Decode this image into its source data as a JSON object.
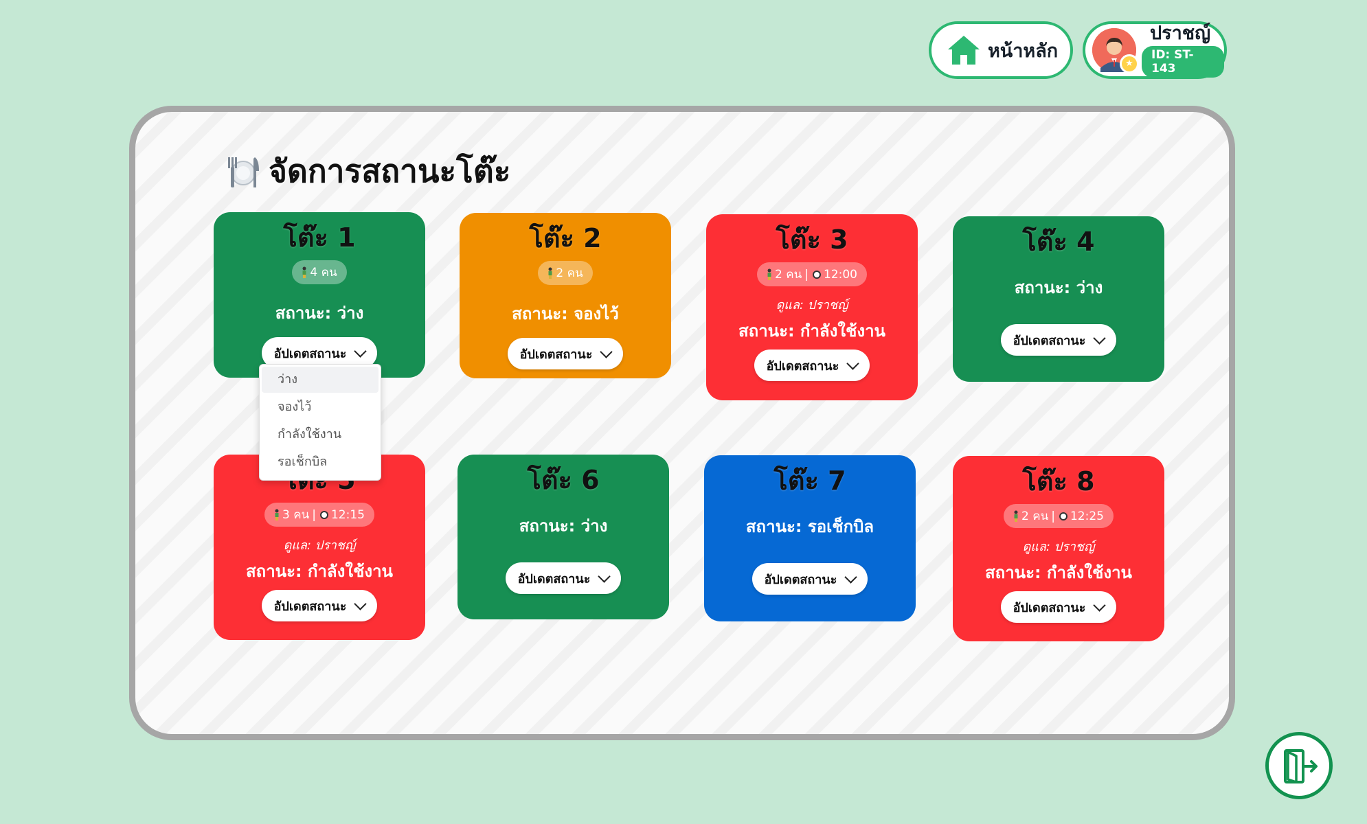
{
  "header": {
    "home_label": "หน้าหลัก",
    "user_name": "ปราชญ์",
    "user_id": "ID: ST-143"
  },
  "page": {
    "title": "จัดการสถานะโต๊ะ"
  },
  "colors": {
    "available": "#178f53",
    "reserved": "#f08f00",
    "occupied": "#fd2f35",
    "awaiting_bill": "#0669d4",
    "accent": "#2db872",
    "background": "#c5e8d4"
  },
  "tables": [
    {
      "title": "โต๊ะ 1",
      "guests": "4 คน",
      "status": "สถานะ: ว่าง",
      "button": "อัปเดตสถานะ"
    },
    {
      "title": "โต๊ะ 2",
      "guests": "2 คน",
      "status": "สถานะ: จองไว้",
      "button": "อัปเดตสถานะ"
    },
    {
      "title": "โต๊ะ 3",
      "guests": "2 คน",
      "time": "12:00",
      "carer": "ดูแล: ปราชญ์",
      "status": "สถานะ: กำลังใช้งาน",
      "button": "อัปเดตสถานะ"
    },
    {
      "title": "โต๊ะ 4",
      "status": "สถานะ: ว่าง",
      "button": "อัปเดตสถานะ"
    },
    {
      "title": "โต๊ะ 5",
      "guests": "3 คน",
      "time": "12:15",
      "carer": "ดูแล: ปราชญ์",
      "status": "สถานะ: กำลังใช้งาน",
      "button": "อัปเดตสถานะ"
    },
    {
      "title": "โต๊ะ 6",
      "status": "สถานะ: ว่าง",
      "button": "อัปเดตสถานะ"
    },
    {
      "title": "โต๊ะ 7",
      "status": "สถานะ: รอเช็กบิล",
      "button": "อัปเดตสถานะ"
    },
    {
      "title": "โต๊ะ 8",
      "guests": "2 คน",
      "time": "12:25",
      "carer": "ดูแล: ปราชญ์",
      "status": "สถานะ: กำลังใช้งาน",
      "button": "อัปเดตสถานะ"
    }
  ],
  "dropdown": {
    "options": [
      "ว่าง",
      "จองไว้",
      "กำลังใช้งาน",
      "รอเช็กบิล"
    ],
    "selected": "ว่าง"
  },
  "icons": {
    "home": "house-icon",
    "title": "utensils-plate-icon",
    "guests": "person-icon",
    "time": "stopwatch-icon",
    "logout": "door-exit-icon"
  }
}
